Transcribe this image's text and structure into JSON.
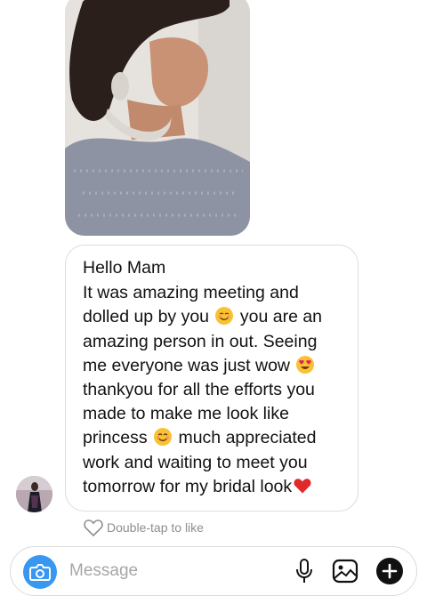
{
  "chat": {
    "photo": {
      "icon": "shared-photo-woman"
    },
    "message_lines": [
      "Hello Mam",
      "It was amazing meeting and",
      "dolled up by you",
      "you are an",
      "amazing person in out. Seeing",
      "me everyone was just wow",
      "thankyou for all the efforts you",
      "made to make me look like",
      "princess",
      "much appreciated",
      "work and waiting to meet you",
      "tomorrow for my bridal look"
    ],
    "emojis": [
      "smiling-face-emoji",
      "heart-eyes-emoji",
      "smiling-face-emoji",
      "red-heart-emoji"
    ],
    "like_hint": "Double-tap to like"
  },
  "composer": {
    "placeholder": "Message",
    "icons": [
      "camera-icon",
      "microphone-icon",
      "gallery-icon",
      "plus-icon"
    ],
    "camera_color": "#3897f0"
  }
}
